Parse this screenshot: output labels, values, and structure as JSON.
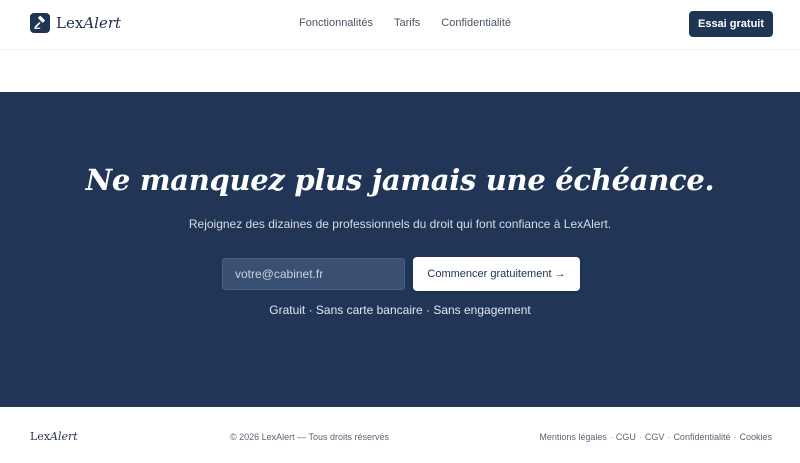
{
  "brand": {
    "name_prefix": "Lex",
    "name_suffix": "Alert"
  },
  "nav": {
    "items": [
      {
        "label": "Fonctionnalités"
      },
      {
        "label": "Tarifs"
      },
      {
        "label": "Confidentialité"
      }
    ],
    "cta_label": "Essai gratuit"
  },
  "hero": {
    "title": "Ne manquez plus jamais une échéance.",
    "subtitle": "Rejoignez des dizaines de professionnels du droit qui font confiance à LexAlert.",
    "email_placeholder": "votre@cabinet.fr",
    "button_label": "Commencer gratuitement →",
    "note": "Gratuit · Sans carte bancaire · Sans engagement"
  },
  "footer": {
    "copyright": "© 2026 LexAlert — Tous droits réservés",
    "links": [
      {
        "label": "Mentions légales"
      },
      {
        "label": "CGU"
      },
      {
        "label": "CGV"
      },
      {
        "label": "Confidentialité"
      },
      {
        "label": "Cookies"
      }
    ],
    "separator": "·"
  },
  "icons": {
    "logo": "gavel-icon"
  },
  "colors": {
    "primary": "#213657",
    "white": "#ffffff"
  }
}
